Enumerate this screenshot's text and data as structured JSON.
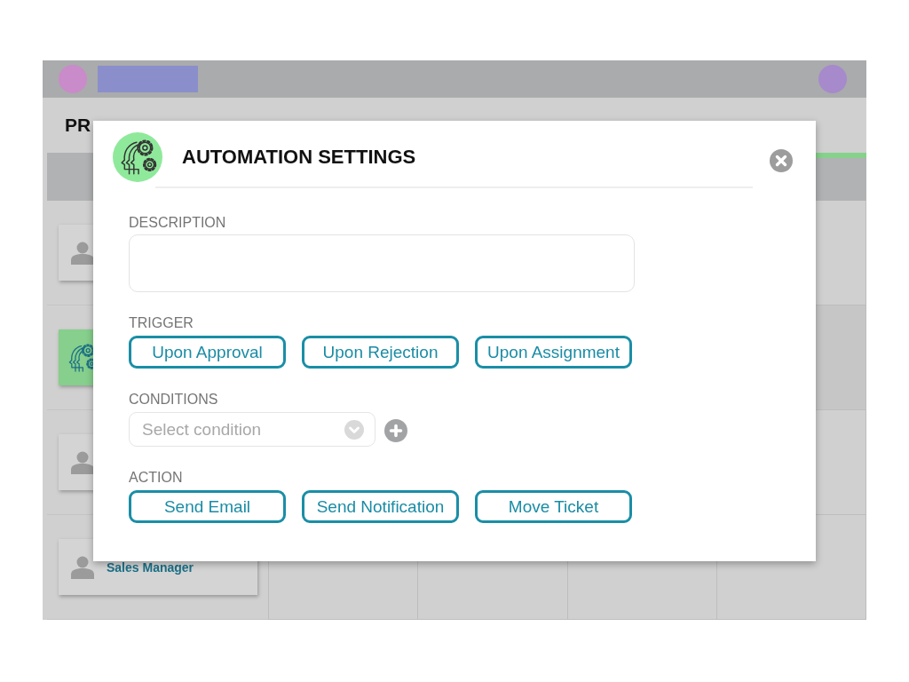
{
  "page": {
    "title": "PR"
  },
  "lanes": [
    {
      "kind": "person"
    },
    {
      "kind": "automation"
    },
    {
      "kind": "person"
    },
    {
      "kind": "person",
      "label": "Sales Manager"
    }
  ],
  "modal": {
    "title": "AUTOMATION SETTINGS",
    "sections": [
      {
        "kind": "text_area",
        "label": "DESCRIPTION"
      },
      {
        "kind": "button_group",
        "label": "TRIGGER",
        "options": [
          "Upon Approval",
          "Upon Rejection",
          "Upon Assignment"
        ]
      },
      {
        "kind": "select",
        "label": "CONDITIONS",
        "placeholder": "Select condition"
      },
      {
        "kind": "button_group",
        "label": "ACTION",
        "options": [
          "Send Email",
          "Send Notification",
          "Move Ticket"
        ]
      }
    ]
  }
}
